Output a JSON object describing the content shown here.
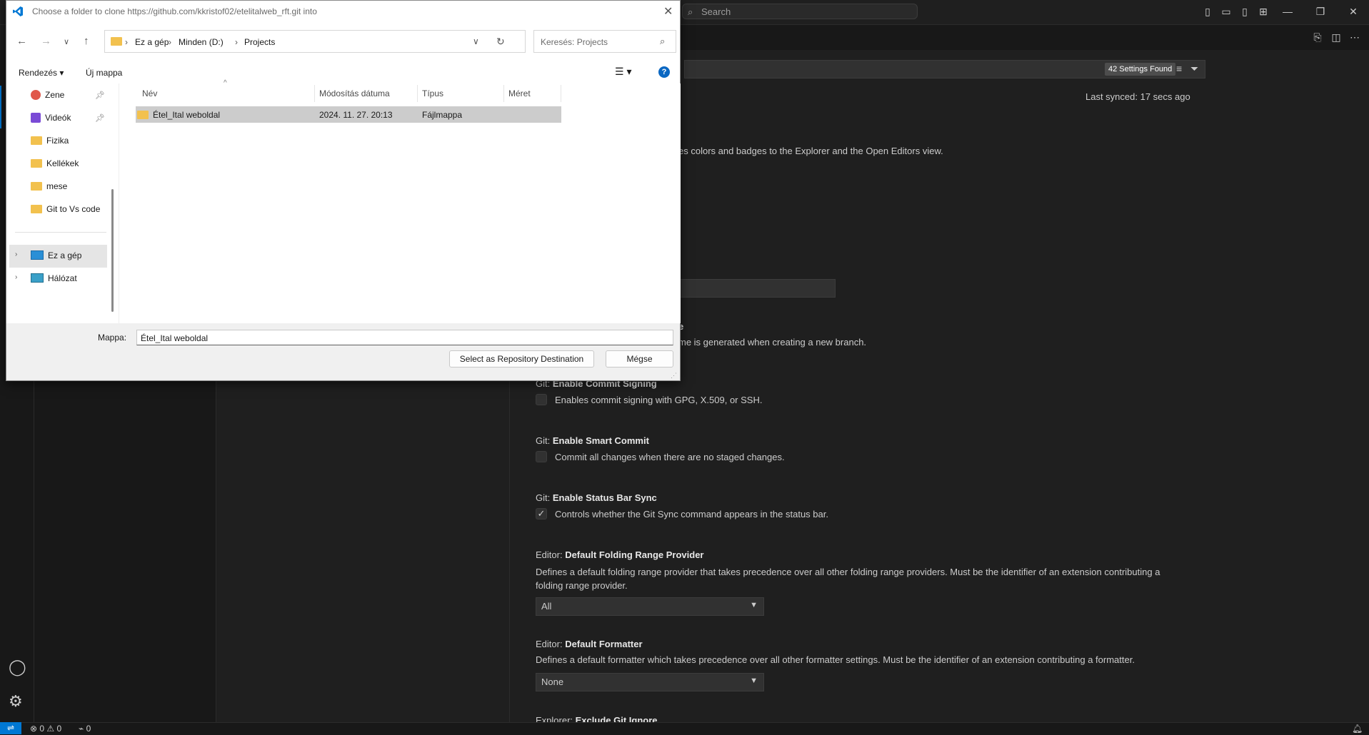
{
  "vscode": {
    "command_search": "Search",
    "settings_found": "42 Settings Found",
    "last_synced": "Last synced: 17 secs ago",
    "partial_desc_1": "es colors and badges to the Explorer and the Open Editors view.",
    "partial_title_branch": "e",
    "partial_desc_branch": "me is generated when creating a new branch.",
    "settings": [
      {
        "prefix": "Git: ",
        "name": "Enable Commit Signing",
        "desc": "Enables commit signing with GPG, X.509, or SSH.",
        "checked": false
      },
      {
        "prefix": "Git: ",
        "name": "Enable Smart Commit",
        "desc": "Commit all changes when there are no staged changes.",
        "checked": false
      },
      {
        "prefix": "Git: ",
        "name": "Enable Status Bar Sync",
        "desc": "Controls whether the Git Sync command appears in the status bar.",
        "checked": true
      }
    ],
    "folding": {
      "prefix": "Editor: ",
      "name": "Default Folding Range Provider",
      "desc": "Defines a default folding range provider that takes precedence over all other folding range providers. Must be the identifier of an extension contributing a folding range provider.",
      "value": "All"
    },
    "formatter": {
      "prefix": "Editor: ",
      "name": "Default Formatter",
      "desc": "Defines a default formatter which takes precedence over all other formatter settings. Must be the identifier of an extension contributing a formatter.",
      "value": "None"
    },
    "exclude_git": {
      "prefix": "Explorer: ",
      "name": "Exclude Git Ignore"
    },
    "status": {
      "errors": "0",
      "warnings": "0",
      "ports": "0"
    }
  },
  "dialog": {
    "title": "Choose a folder to clone https://github.com/kkristof02/etelitalweb_rft.git into",
    "breadcrumb": [
      "Ez a gép",
      "Minden (D:)",
      "Projects"
    ],
    "search_placeholder": "Keresés: Projects",
    "organize": "Rendezés",
    "new_folder": "Új mappa",
    "nav_items": [
      "Zene",
      "Videók",
      "Fizika",
      "Kellékek",
      "mese",
      "Git to Vs code"
    ],
    "nav_roots": [
      "Ez a gép",
      "Hálózat"
    ],
    "columns": [
      "Név",
      "Módosítás dátuma",
      "Típus",
      "Méret"
    ],
    "rows": [
      {
        "name": "Étel_Ital weboldal",
        "date": "2024. 11. 27. 20:13",
        "type": "Fájlmappa",
        "size": ""
      }
    ],
    "folder_label": "Mappa:",
    "folder_value": "Étel_Ital weboldal",
    "select_button": "Select as Repository Destination",
    "cancel_button": "Mégse"
  },
  "colors": {
    "accent": "#0078d4",
    "folder": "#f2c14e",
    "vscode_bg": "#1f1f1f"
  }
}
